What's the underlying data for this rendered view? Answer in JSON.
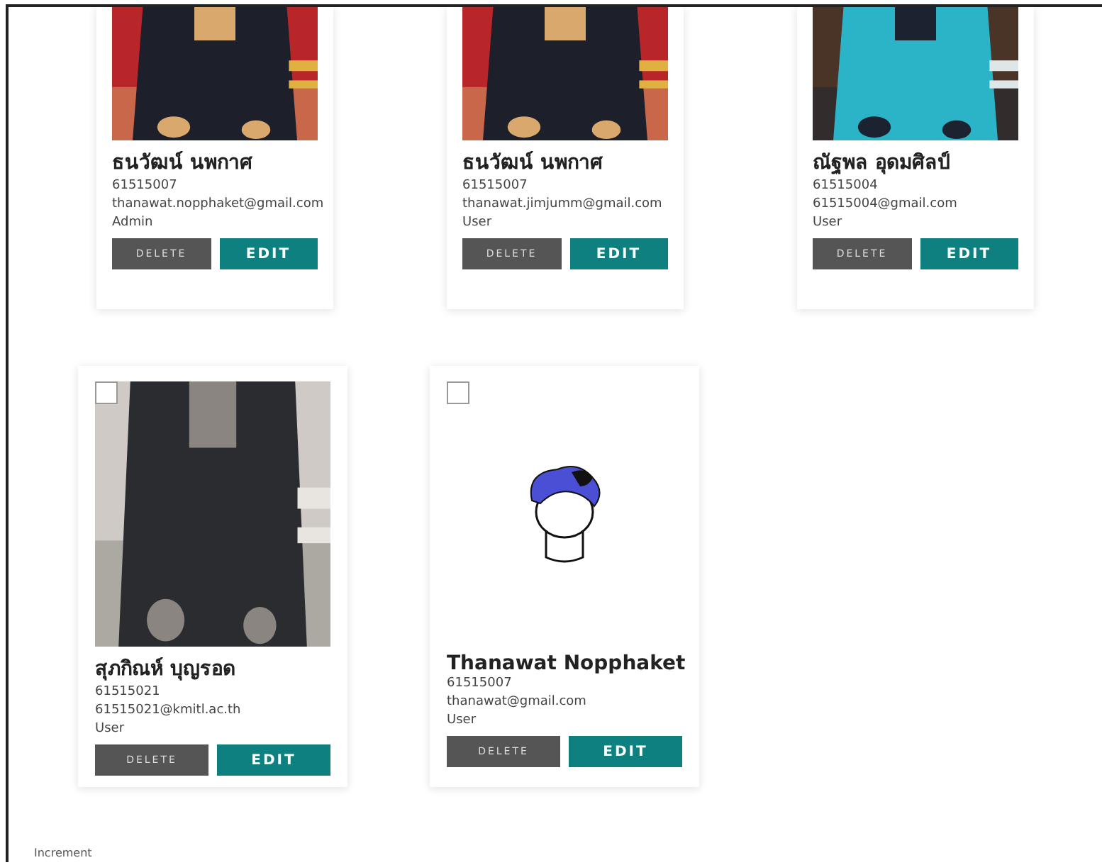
{
  "rows": [
    {
      "cards": [
        {
          "picture": {
            "kind": "picture"
          },
          "name": "ธนวัฒน์ นพกาศ",
          "student_id": "61515007",
          "email": "thanawat.nopphaket@gmail.com",
          "role": "Admin",
          "buttons": [
            "DELETE",
            "EDIT"
          ]
        },
        {
          "picture": {
            "kind": "picture"
          },
          "name": "ธนวัฒน์ นพกาศ",
          "student_id": "61515007",
          "email": "thanawat.jimjumm@gmail.com",
          "role": "User",
          "buttons": [
            "DELETE",
            "EDIT"
          ]
        },
        {
          "picture": {
            "kind": "picture"
          },
          "name": "ณัฐพล อุดมศิลป์",
          "student_id": "61515004",
          "email": "61515004@gmail.com",
          "role": "User",
          "buttons": [
            "DELETE",
            "EDIT"
          ]
        }
      ]
    },
    {
      "cards": [
        {
          "checked": false,
          "picture": {
            "kind": "picture"
          },
          "name": "สุภกิณห์ บุญรอด",
          "student_id": "61515021",
          "email": "61515021@kmitl.ac.th",
          "role": "User",
          "buttons": [
            "DELETE",
            "EDIT"
          ]
        },
        {
          "checked": false,
          "picture": {
            "kind": "illustration"
          },
          "name": "Thanawat Nopphaket",
          "student_id": "61515007",
          "email": "thanawat@gmail.com",
          "role": "User",
          "buttons": [
            "DELETE",
            "EDIT"
          ]
        }
      ]
    }
  ],
  "footer": {
    "label": "Increment"
  }
}
